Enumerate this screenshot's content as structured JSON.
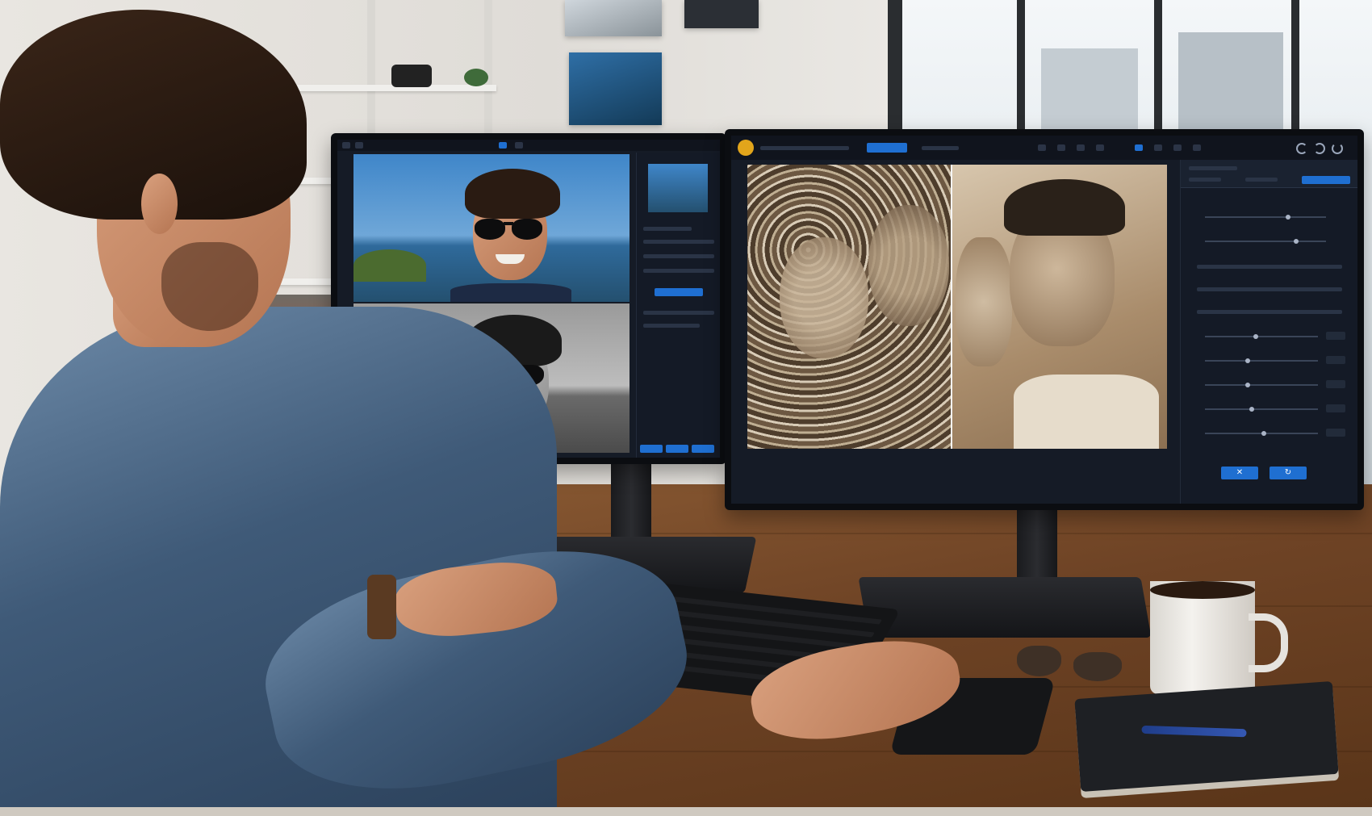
{
  "scene": {
    "colors": {
      "wall": "#e6e3de",
      "desk_wood": "#6e4325",
      "monitor_bezel": "#0b0d11",
      "app_bg": "#151b26",
      "accent_blue": "#1f6fd1",
      "sepia": "#b79a78",
      "shirt_denim": "#3f5a78"
    },
    "icons": [
      "logo-badge-icon",
      "undo-icon",
      "redo-icon",
      "close-icon",
      "apply-icon"
    ]
  },
  "left_monitor": {
    "app": {
      "panels": [
        "color-photo",
        "bw-photo",
        "settings-panel"
      ]
    }
  },
  "right_monitor": {
    "app": {
      "compare_split": 0.5
    }
  }
}
